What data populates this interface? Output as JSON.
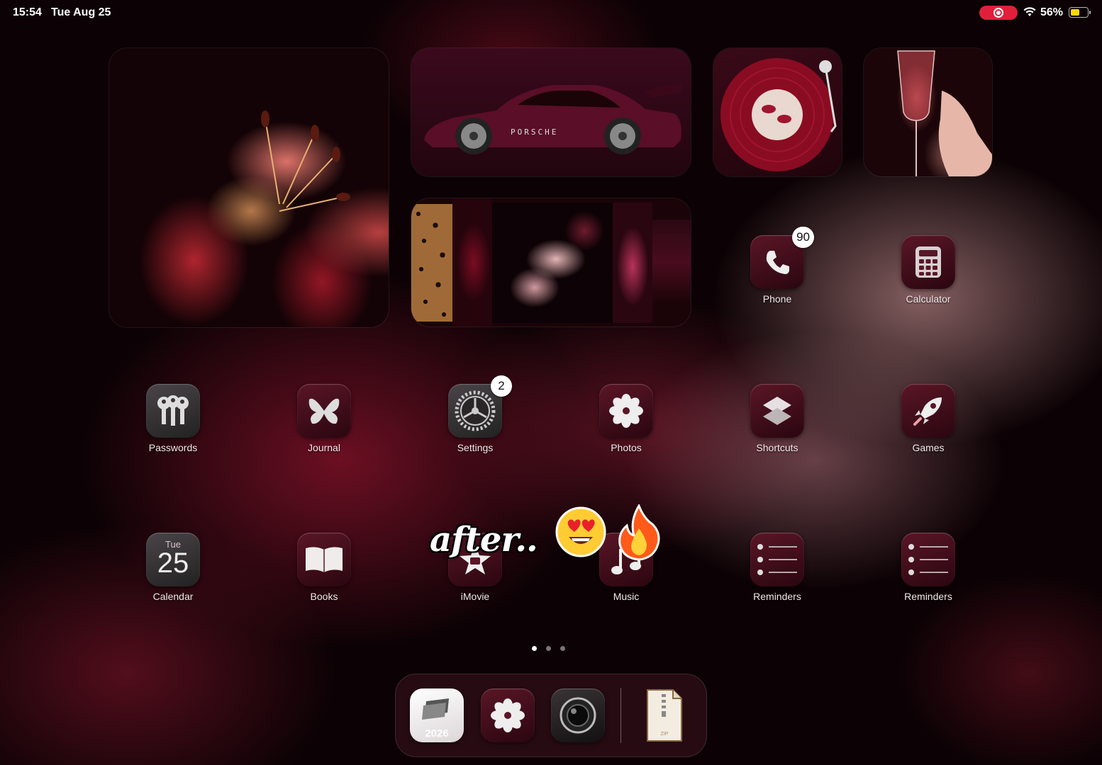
{
  "status_bar": {
    "time": "15:54",
    "date": "Tue Aug 25",
    "battery_percent": "56%",
    "battery_level": 0.56,
    "recording": true
  },
  "widgets": {
    "car_brand": "PORSCHE"
  },
  "apps": {
    "phone": {
      "label": "Phone",
      "badge": "90"
    },
    "calculator": {
      "label": "Calculator"
    },
    "passwords": {
      "label": "Passwords"
    },
    "journal": {
      "label": "Journal"
    },
    "settings": {
      "label": "Settings",
      "badge": "2"
    },
    "photos": {
      "label": "Photos"
    },
    "shortcuts": {
      "label": "Shortcuts"
    },
    "games": {
      "label": "Games"
    },
    "calendar": {
      "label": "Calendar",
      "day": "Tue",
      "date": "25"
    },
    "books": {
      "label": "Books"
    },
    "imovie": {
      "label": "iMovie"
    },
    "music": {
      "label": "Music"
    },
    "reminders_1": {
      "label": "Reminders"
    },
    "reminders_2": {
      "label": "Reminders"
    }
  },
  "overlay": {
    "sticker_text": "after.."
  },
  "page_indicator": {
    "pages": 3,
    "current": 1
  },
  "dock": {
    "year_app_label": "2026",
    "zip_label": "ZIP"
  },
  "colors": {
    "accent": "#5a1626",
    "record": "#e0203a",
    "battery": "#ffd60a"
  }
}
